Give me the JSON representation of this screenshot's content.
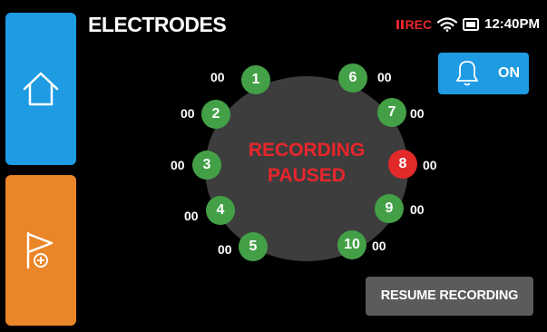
{
  "header": {
    "title": "ELECTRODES"
  },
  "status_bar": {
    "rec_label": "REC",
    "time": "12:40PM",
    "rec_color": "#e8262c"
  },
  "sidebar": {
    "home_icon": "home-icon",
    "flag_icon": "flag-add-icon"
  },
  "alarm": {
    "state": "ON",
    "icon": "bell-icon"
  },
  "recording": {
    "line1": "RECORDING",
    "line2": "PAUSED"
  },
  "electrodes": [
    {
      "id": "1",
      "value": "00",
      "status": "ok"
    },
    {
      "id": "2",
      "value": "00",
      "status": "ok"
    },
    {
      "id": "3",
      "value": "00",
      "status": "ok"
    },
    {
      "id": "4",
      "value": "00",
      "status": "ok"
    },
    {
      "id": "5",
      "value": "00",
      "status": "ok"
    },
    {
      "id": "6",
      "value": "00",
      "status": "ok"
    },
    {
      "id": "7",
      "value": "00",
      "status": "ok"
    },
    {
      "id": "8",
      "value": "00",
      "status": "alert"
    },
    {
      "id": "9",
      "value": "00",
      "status": "ok"
    },
    {
      "id": "10",
      "value": "00",
      "status": "ok"
    }
  ],
  "actions": {
    "resume_label": "RESUME RECORDING"
  },
  "colors": {
    "blue": "#1e9be2",
    "orange": "#ea8528",
    "green": "#43a047",
    "red": "#e32a2a"
  }
}
